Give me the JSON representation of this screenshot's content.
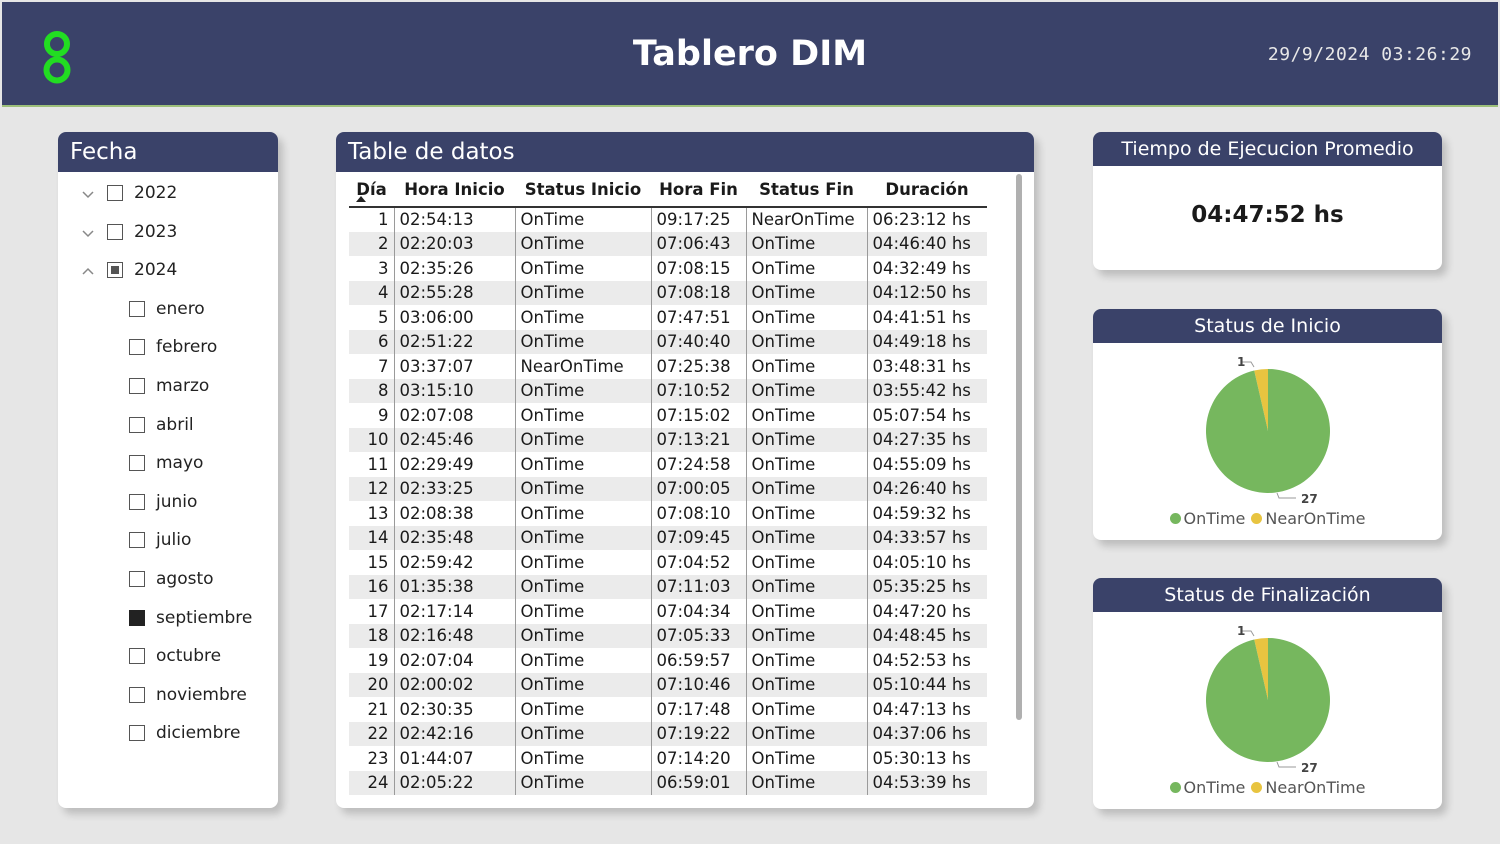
{
  "header": {
    "title": "Tablero DIM",
    "datetime": "29/9/2024  03:26:29",
    "logo_color": "#22dd22"
  },
  "fecha": {
    "title": "Fecha",
    "years": [
      {
        "label": "2022",
        "expanded": false,
        "state": "unchecked"
      },
      {
        "label": "2023",
        "expanded": false,
        "state": "unchecked"
      },
      {
        "label": "2024",
        "expanded": true,
        "state": "partial"
      }
    ],
    "months": [
      {
        "label": "enero",
        "state": "unchecked"
      },
      {
        "label": "febrero",
        "state": "unchecked"
      },
      {
        "label": "marzo",
        "state": "unchecked"
      },
      {
        "label": "abril",
        "state": "unchecked"
      },
      {
        "label": "mayo",
        "state": "unchecked"
      },
      {
        "label": "junio",
        "state": "unchecked"
      },
      {
        "label": "julio",
        "state": "unchecked"
      },
      {
        "label": "agosto",
        "state": "unchecked"
      },
      {
        "label": "septiembre",
        "state": "checked"
      },
      {
        "label": "octubre",
        "state": "unchecked"
      },
      {
        "label": "noviembre",
        "state": "unchecked"
      },
      {
        "label": "diciembre",
        "state": "unchecked"
      }
    ]
  },
  "table": {
    "title": "Table de datos",
    "columns": [
      "Día",
      "Hora Inicio",
      "Status Inicio",
      "Hora Fin",
      "Status Fin",
      "Duración"
    ],
    "sorted_column": "Día",
    "rows": [
      [
        "1",
        "02:54:13",
        "OnTime",
        "09:17:25",
        "NearOnTime",
        "06:23:12 hs"
      ],
      [
        "2",
        "02:20:03",
        "OnTime",
        "07:06:43",
        "OnTime",
        "04:46:40 hs"
      ],
      [
        "3",
        "02:35:26",
        "OnTime",
        "07:08:15",
        "OnTime",
        "04:32:49 hs"
      ],
      [
        "4",
        "02:55:28",
        "OnTime",
        "07:08:18",
        "OnTime",
        "04:12:50 hs"
      ],
      [
        "5",
        "03:06:00",
        "OnTime",
        "07:47:51",
        "OnTime",
        "04:41:51 hs"
      ],
      [
        "6",
        "02:51:22",
        "OnTime",
        "07:40:40",
        "OnTime",
        "04:49:18 hs"
      ],
      [
        "7",
        "03:37:07",
        "NearOnTime",
        "07:25:38",
        "OnTime",
        "03:48:31 hs"
      ],
      [
        "8",
        "03:15:10",
        "OnTime",
        "07:10:52",
        "OnTime",
        "03:55:42 hs"
      ],
      [
        "9",
        "02:07:08",
        "OnTime",
        "07:15:02",
        "OnTime",
        "05:07:54 hs"
      ],
      [
        "10",
        "02:45:46",
        "OnTime",
        "07:13:21",
        "OnTime",
        "04:27:35 hs"
      ],
      [
        "11",
        "02:29:49",
        "OnTime",
        "07:24:58",
        "OnTime",
        "04:55:09 hs"
      ],
      [
        "12",
        "02:33:25",
        "OnTime",
        "07:00:05",
        "OnTime",
        "04:26:40 hs"
      ],
      [
        "13",
        "02:08:38",
        "OnTime",
        "07:08:10",
        "OnTime",
        "04:59:32 hs"
      ],
      [
        "14",
        "02:35:48",
        "OnTime",
        "07:09:45",
        "OnTime",
        "04:33:57 hs"
      ],
      [
        "15",
        "02:59:42",
        "OnTime",
        "07:04:52",
        "OnTime",
        "04:05:10 hs"
      ],
      [
        "16",
        "01:35:38",
        "OnTime",
        "07:11:03",
        "OnTime",
        "05:35:25 hs"
      ],
      [
        "17",
        "02:17:14",
        "OnTime",
        "07:04:34",
        "OnTime",
        "04:47:20 hs"
      ],
      [
        "18",
        "02:16:48",
        "OnTime",
        "07:05:33",
        "OnTime",
        "04:48:45 hs"
      ],
      [
        "19",
        "02:07:04",
        "OnTime",
        "06:59:57",
        "OnTime",
        "04:52:53 hs"
      ],
      [
        "20",
        "02:00:02",
        "OnTime",
        "07:10:46",
        "OnTime",
        "05:10:44 hs"
      ],
      [
        "21",
        "02:30:35",
        "OnTime",
        "07:17:48",
        "OnTime",
        "04:47:13 hs"
      ],
      [
        "22",
        "02:42:16",
        "OnTime",
        "07:19:22",
        "OnTime",
        "04:37:06 hs"
      ],
      [
        "23",
        "01:44:07",
        "OnTime",
        "07:14:20",
        "OnTime",
        "05:30:13 hs"
      ],
      [
        "24",
        "02:05:22",
        "OnTime",
        "06:59:01",
        "OnTime",
        "04:53:39 hs"
      ]
    ]
  },
  "avg": {
    "title": "Tiempo de Ejecucion Promedio",
    "value": "04:47:52 hs"
  },
  "status_inicio": {
    "title": "Status de Inicio",
    "chart_data": {
      "type": "pie",
      "slices": [
        {
          "label": "OnTime",
          "value": 27,
          "color": "#76b75e"
        },
        {
          "label": "NearOnTime",
          "value": 1,
          "color": "#e8c440"
        }
      ],
      "legend": [
        "OnTime",
        "NearOnTime"
      ]
    }
  },
  "status_fin": {
    "title": "Status de Finalización",
    "chart_data": {
      "type": "pie",
      "slices": [
        {
          "label": "OnTime",
          "value": 27,
          "color": "#76b75e"
        },
        {
          "label": "NearOnTime",
          "value": 1,
          "color": "#e8c440"
        }
      ],
      "legend": [
        "OnTime",
        "NearOnTime"
      ]
    }
  }
}
